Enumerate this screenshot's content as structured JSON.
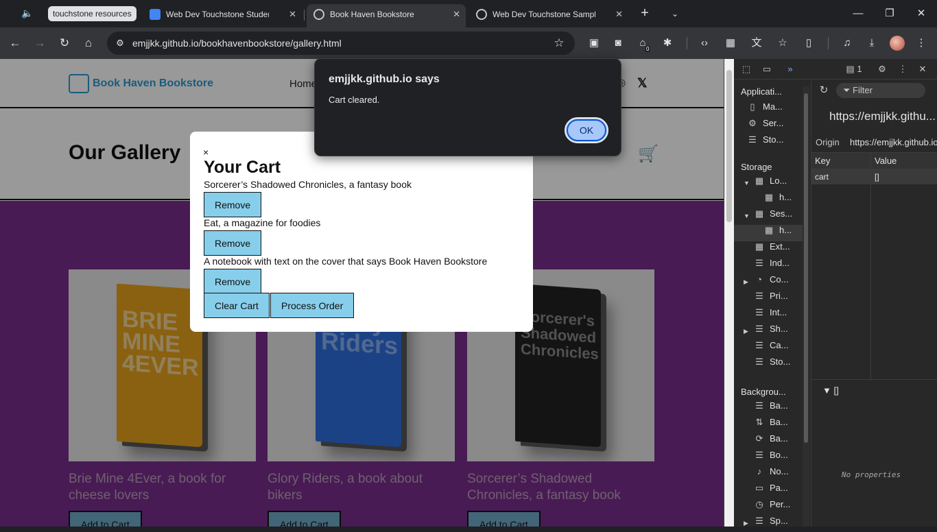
{
  "tabs": {
    "group_label": "touchstone resources",
    "items": [
      {
        "title": "Web Dev Touchstone Student Te",
        "active": false
      },
      {
        "title": "Book Haven Bookstore",
        "active": true
      },
      {
        "title": "Web Dev Touchstone Sample Su",
        "active": false
      }
    ]
  },
  "toolbar": {
    "url": "emjjkk.github.io/bookhavenbookstore/gallery.html",
    "extension_badge": "0"
  },
  "site": {
    "logo_text": "Book Haven Bookstore",
    "nav_home": "Home",
    "gallery_title": "Our Gallery",
    "cards": [
      {
        "cover_text": "BRIE MINE 4EVER",
        "caption": "Brie Mine 4Ever, a book for cheese lovers",
        "button": "Add to Cart",
        "cover_color": "#e7a21b"
      },
      {
        "cover_text": "Glory Riders",
        "caption": "Glory Riders, a book about bikers",
        "button": "Add to Cart",
        "cover_color": "#2f6fe0"
      },
      {
        "cover_text": "Sorcerer's Shadowed Chronicles",
        "caption": "Sorcerer’s Shadowed Chronicles, a fantasy book",
        "button": "Add to Cart",
        "cover_color": "#222222"
      }
    ]
  },
  "cart": {
    "close": "×",
    "title": "Your Cart",
    "items": [
      {
        "name": "Sorcerer’s Shadowed Chronicles, a fantasy book",
        "remove": "Remove"
      },
      {
        "name": "Eat, a magazine for foodies",
        "remove": "Remove"
      },
      {
        "name": "A notebook with text on the cover that says Book Haven Bookstore",
        "remove": "Remove"
      }
    ],
    "clear_label": "Clear Cart",
    "process_label": "Process Order"
  },
  "alert": {
    "title": "emjjkk.github.io says",
    "message": "Cart cleared.",
    "ok_label": "OK"
  },
  "devtools": {
    "message_count": "1",
    "application_header": "Applicati...",
    "app_items": [
      {
        "icon": "document-icon",
        "label": "Ma..."
      },
      {
        "icon": "gears-icon",
        "label": "Ser..."
      },
      {
        "icon": "database-icon",
        "label": "Sto..."
      }
    ],
    "storage_header": "Storage",
    "storage_items": [
      {
        "label": "Lo...",
        "expanded": true
      },
      {
        "label": "h..."
      },
      {
        "label": "Ses...",
        "expanded": true
      },
      {
        "label": "h...",
        "selected": true
      },
      {
        "label": "Ext..."
      },
      {
        "label": "Ind..."
      },
      {
        "label": "Co..."
      },
      {
        "label": "Pri..."
      },
      {
        "label": "Int..."
      },
      {
        "label": "Sh..."
      },
      {
        "label": "Ca..."
      },
      {
        "label": "Sto..."
      }
    ],
    "background_header": "Backgrou...",
    "background_items": [
      {
        "label": "Ba..."
      },
      {
        "label": "Ba..."
      },
      {
        "label": "Ba..."
      },
      {
        "label": "Bo..."
      },
      {
        "label": "No..."
      },
      {
        "label": "Pa..."
      },
      {
        "label": "Per..."
      },
      {
        "label": "Sp..."
      }
    ],
    "filter_placeholder": "Filter",
    "origin_url": "https://emjjkk.githu...",
    "origin_label": "Origin",
    "origin_value": "https://emjjkk.github.io",
    "table": {
      "headers": [
        "Key",
        "Value"
      ],
      "rows": [
        {
          "key": "cart",
          "value": "[]"
        }
      ]
    },
    "preview_value": "[]",
    "no_properties": "No properties"
  }
}
